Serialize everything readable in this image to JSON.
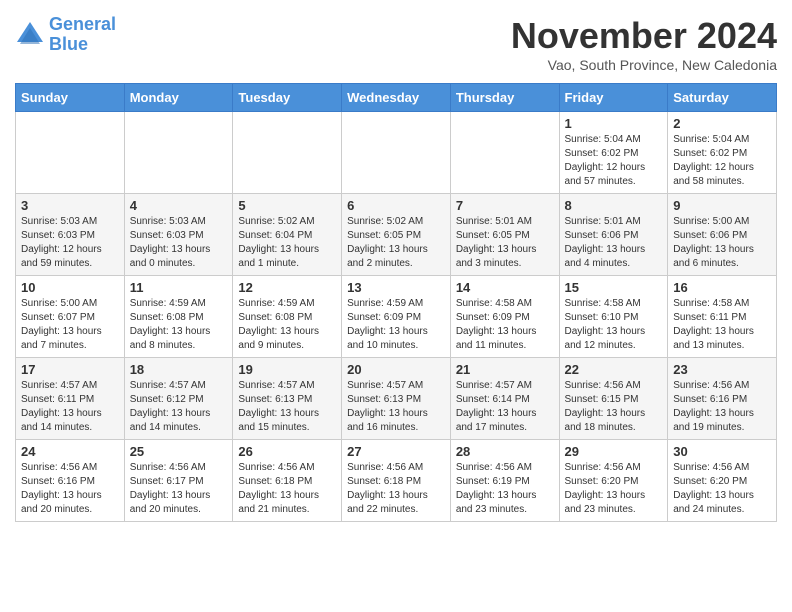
{
  "header": {
    "logo_line1": "General",
    "logo_line2": "Blue",
    "title": "November 2024",
    "location": "Vao, South Province, New Caledonia"
  },
  "weekdays": [
    "Sunday",
    "Monday",
    "Tuesday",
    "Wednesday",
    "Thursday",
    "Friday",
    "Saturday"
  ],
  "weeks": [
    [
      {
        "day": "",
        "info": ""
      },
      {
        "day": "",
        "info": ""
      },
      {
        "day": "",
        "info": ""
      },
      {
        "day": "",
        "info": ""
      },
      {
        "day": "",
        "info": ""
      },
      {
        "day": "1",
        "info": "Sunrise: 5:04 AM\nSunset: 6:02 PM\nDaylight: 12 hours\nand 57 minutes."
      },
      {
        "day": "2",
        "info": "Sunrise: 5:04 AM\nSunset: 6:02 PM\nDaylight: 12 hours\nand 58 minutes."
      }
    ],
    [
      {
        "day": "3",
        "info": "Sunrise: 5:03 AM\nSunset: 6:03 PM\nDaylight: 12 hours\nand 59 minutes."
      },
      {
        "day": "4",
        "info": "Sunrise: 5:03 AM\nSunset: 6:03 PM\nDaylight: 13 hours\nand 0 minutes."
      },
      {
        "day": "5",
        "info": "Sunrise: 5:02 AM\nSunset: 6:04 PM\nDaylight: 13 hours\nand 1 minute."
      },
      {
        "day": "6",
        "info": "Sunrise: 5:02 AM\nSunset: 6:05 PM\nDaylight: 13 hours\nand 2 minutes."
      },
      {
        "day": "7",
        "info": "Sunrise: 5:01 AM\nSunset: 6:05 PM\nDaylight: 13 hours\nand 3 minutes."
      },
      {
        "day": "8",
        "info": "Sunrise: 5:01 AM\nSunset: 6:06 PM\nDaylight: 13 hours\nand 4 minutes."
      },
      {
        "day": "9",
        "info": "Sunrise: 5:00 AM\nSunset: 6:06 PM\nDaylight: 13 hours\nand 6 minutes."
      }
    ],
    [
      {
        "day": "10",
        "info": "Sunrise: 5:00 AM\nSunset: 6:07 PM\nDaylight: 13 hours\nand 7 minutes."
      },
      {
        "day": "11",
        "info": "Sunrise: 4:59 AM\nSunset: 6:08 PM\nDaylight: 13 hours\nand 8 minutes."
      },
      {
        "day": "12",
        "info": "Sunrise: 4:59 AM\nSunset: 6:08 PM\nDaylight: 13 hours\nand 9 minutes."
      },
      {
        "day": "13",
        "info": "Sunrise: 4:59 AM\nSunset: 6:09 PM\nDaylight: 13 hours\nand 10 minutes."
      },
      {
        "day": "14",
        "info": "Sunrise: 4:58 AM\nSunset: 6:09 PM\nDaylight: 13 hours\nand 11 minutes."
      },
      {
        "day": "15",
        "info": "Sunrise: 4:58 AM\nSunset: 6:10 PM\nDaylight: 13 hours\nand 12 minutes."
      },
      {
        "day": "16",
        "info": "Sunrise: 4:58 AM\nSunset: 6:11 PM\nDaylight: 13 hours\nand 13 minutes."
      }
    ],
    [
      {
        "day": "17",
        "info": "Sunrise: 4:57 AM\nSunset: 6:11 PM\nDaylight: 13 hours\nand 14 minutes."
      },
      {
        "day": "18",
        "info": "Sunrise: 4:57 AM\nSunset: 6:12 PM\nDaylight: 13 hours\nand 14 minutes."
      },
      {
        "day": "19",
        "info": "Sunrise: 4:57 AM\nSunset: 6:13 PM\nDaylight: 13 hours\nand 15 minutes."
      },
      {
        "day": "20",
        "info": "Sunrise: 4:57 AM\nSunset: 6:13 PM\nDaylight: 13 hours\nand 16 minutes."
      },
      {
        "day": "21",
        "info": "Sunrise: 4:57 AM\nSunset: 6:14 PM\nDaylight: 13 hours\nand 17 minutes."
      },
      {
        "day": "22",
        "info": "Sunrise: 4:56 AM\nSunset: 6:15 PM\nDaylight: 13 hours\nand 18 minutes."
      },
      {
        "day": "23",
        "info": "Sunrise: 4:56 AM\nSunset: 6:16 PM\nDaylight: 13 hours\nand 19 minutes."
      }
    ],
    [
      {
        "day": "24",
        "info": "Sunrise: 4:56 AM\nSunset: 6:16 PM\nDaylight: 13 hours\nand 20 minutes."
      },
      {
        "day": "25",
        "info": "Sunrise: 4:56 AM\nSunset: 6:17 PM\nDaylight: 13 hours\nand 20 minutes."
      },
      {
        "day": "26",
        "info": "Sunrise: 4:56 AM\nSunset: 6:18 PM\nDaylight: 13 hours\nand 21 minutes."
      },
      {
        "day": "27",
        "info": "Sunrise: 4:56 AM\nSunset: 6:18 PM\nDaylight: 13 hours\nand 22 minutes."
      },
      {
        "day": "28",
        "info": "Sunrise: 4:56 AM\nSunset: 6:19 PM\nDaylight: 13 hours\nand 23 minutes."
      },
      {
        "day": "29",
        "info": "Sunrise: 4:56 AM\nSunset: 6:20 PM\nDaylight: 13 hours\nand 23 minutes."
      },
      {
        "day": "30",
        "info": "Sunrise: 4:56 AM\nSunset: 6:20 PM\nDaylight: 13 hours\nand 24 minutes."
      }
    ]
  ]
}
